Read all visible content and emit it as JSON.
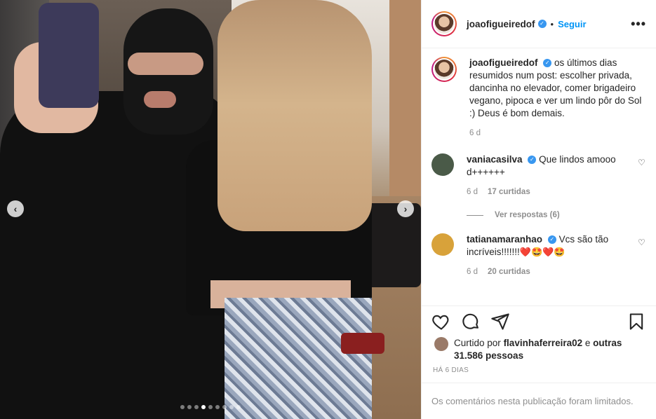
{
  "post": {
    "author": "joaofigueiredof",
    "follow_label": "Seguir",
    "separator": "•",
    "more_label": "•••",
    "caption": "os últimos dias resumidos num post: escolher privada, dancinha no elevador, comer brigadeiro vegano, pipoca e ver um lindo pôr do Sol :) Deus é bom demais.",
    "caption_age": "6 d",
    "carousel": {
      "total_dots": 9,
      "active_dot": 3,
      "prev_label": "‹",
      "next_label": "›"
    }
  },
  "comments": [
    {
      "user": "vaniacasilva",
      "text": "Que lindos amooo d++++++",
      "age": "6 d",
      "likes": "17 curtidas",
      "view_replies": "Ver respostas (6)",
      "avatar_color": "#4a5a48"
    },
    {
      "user": "tatianamaranhao",
      "text": "Vcs são tão incríveis!!!!!!!",
      "emoji": "❤️🤩❤️🤩",
      "age": "6 d",
      "likes": "20 curtidas",
      "avatar_color": "#d8a23a"
    }
  ],
  "actions": {
    "like_icon": "heart-outline-icon",
    "comment_icon": "comment-bubble-icon",
    "share_icon": "paper-plane-icon",
    "save_icon": "bookmark-icon"
  },
  "likes": {
    "prefix": "Curtido por",
    "user": "flavinhaferreira02",
    "conjunction": "e",
    "others": "outras 31.586 pessoas"
  },
  "timestamp": "HÁ 6 DIAS",
  "comments_limited": "Os comentários nesta publicação foram limitados.",
  "colors": {
    "link": "#0095f6",
    "verified": "#3897f0",
    "muted": "#8e8e8e",
    "text": "#262626"
  }
}
